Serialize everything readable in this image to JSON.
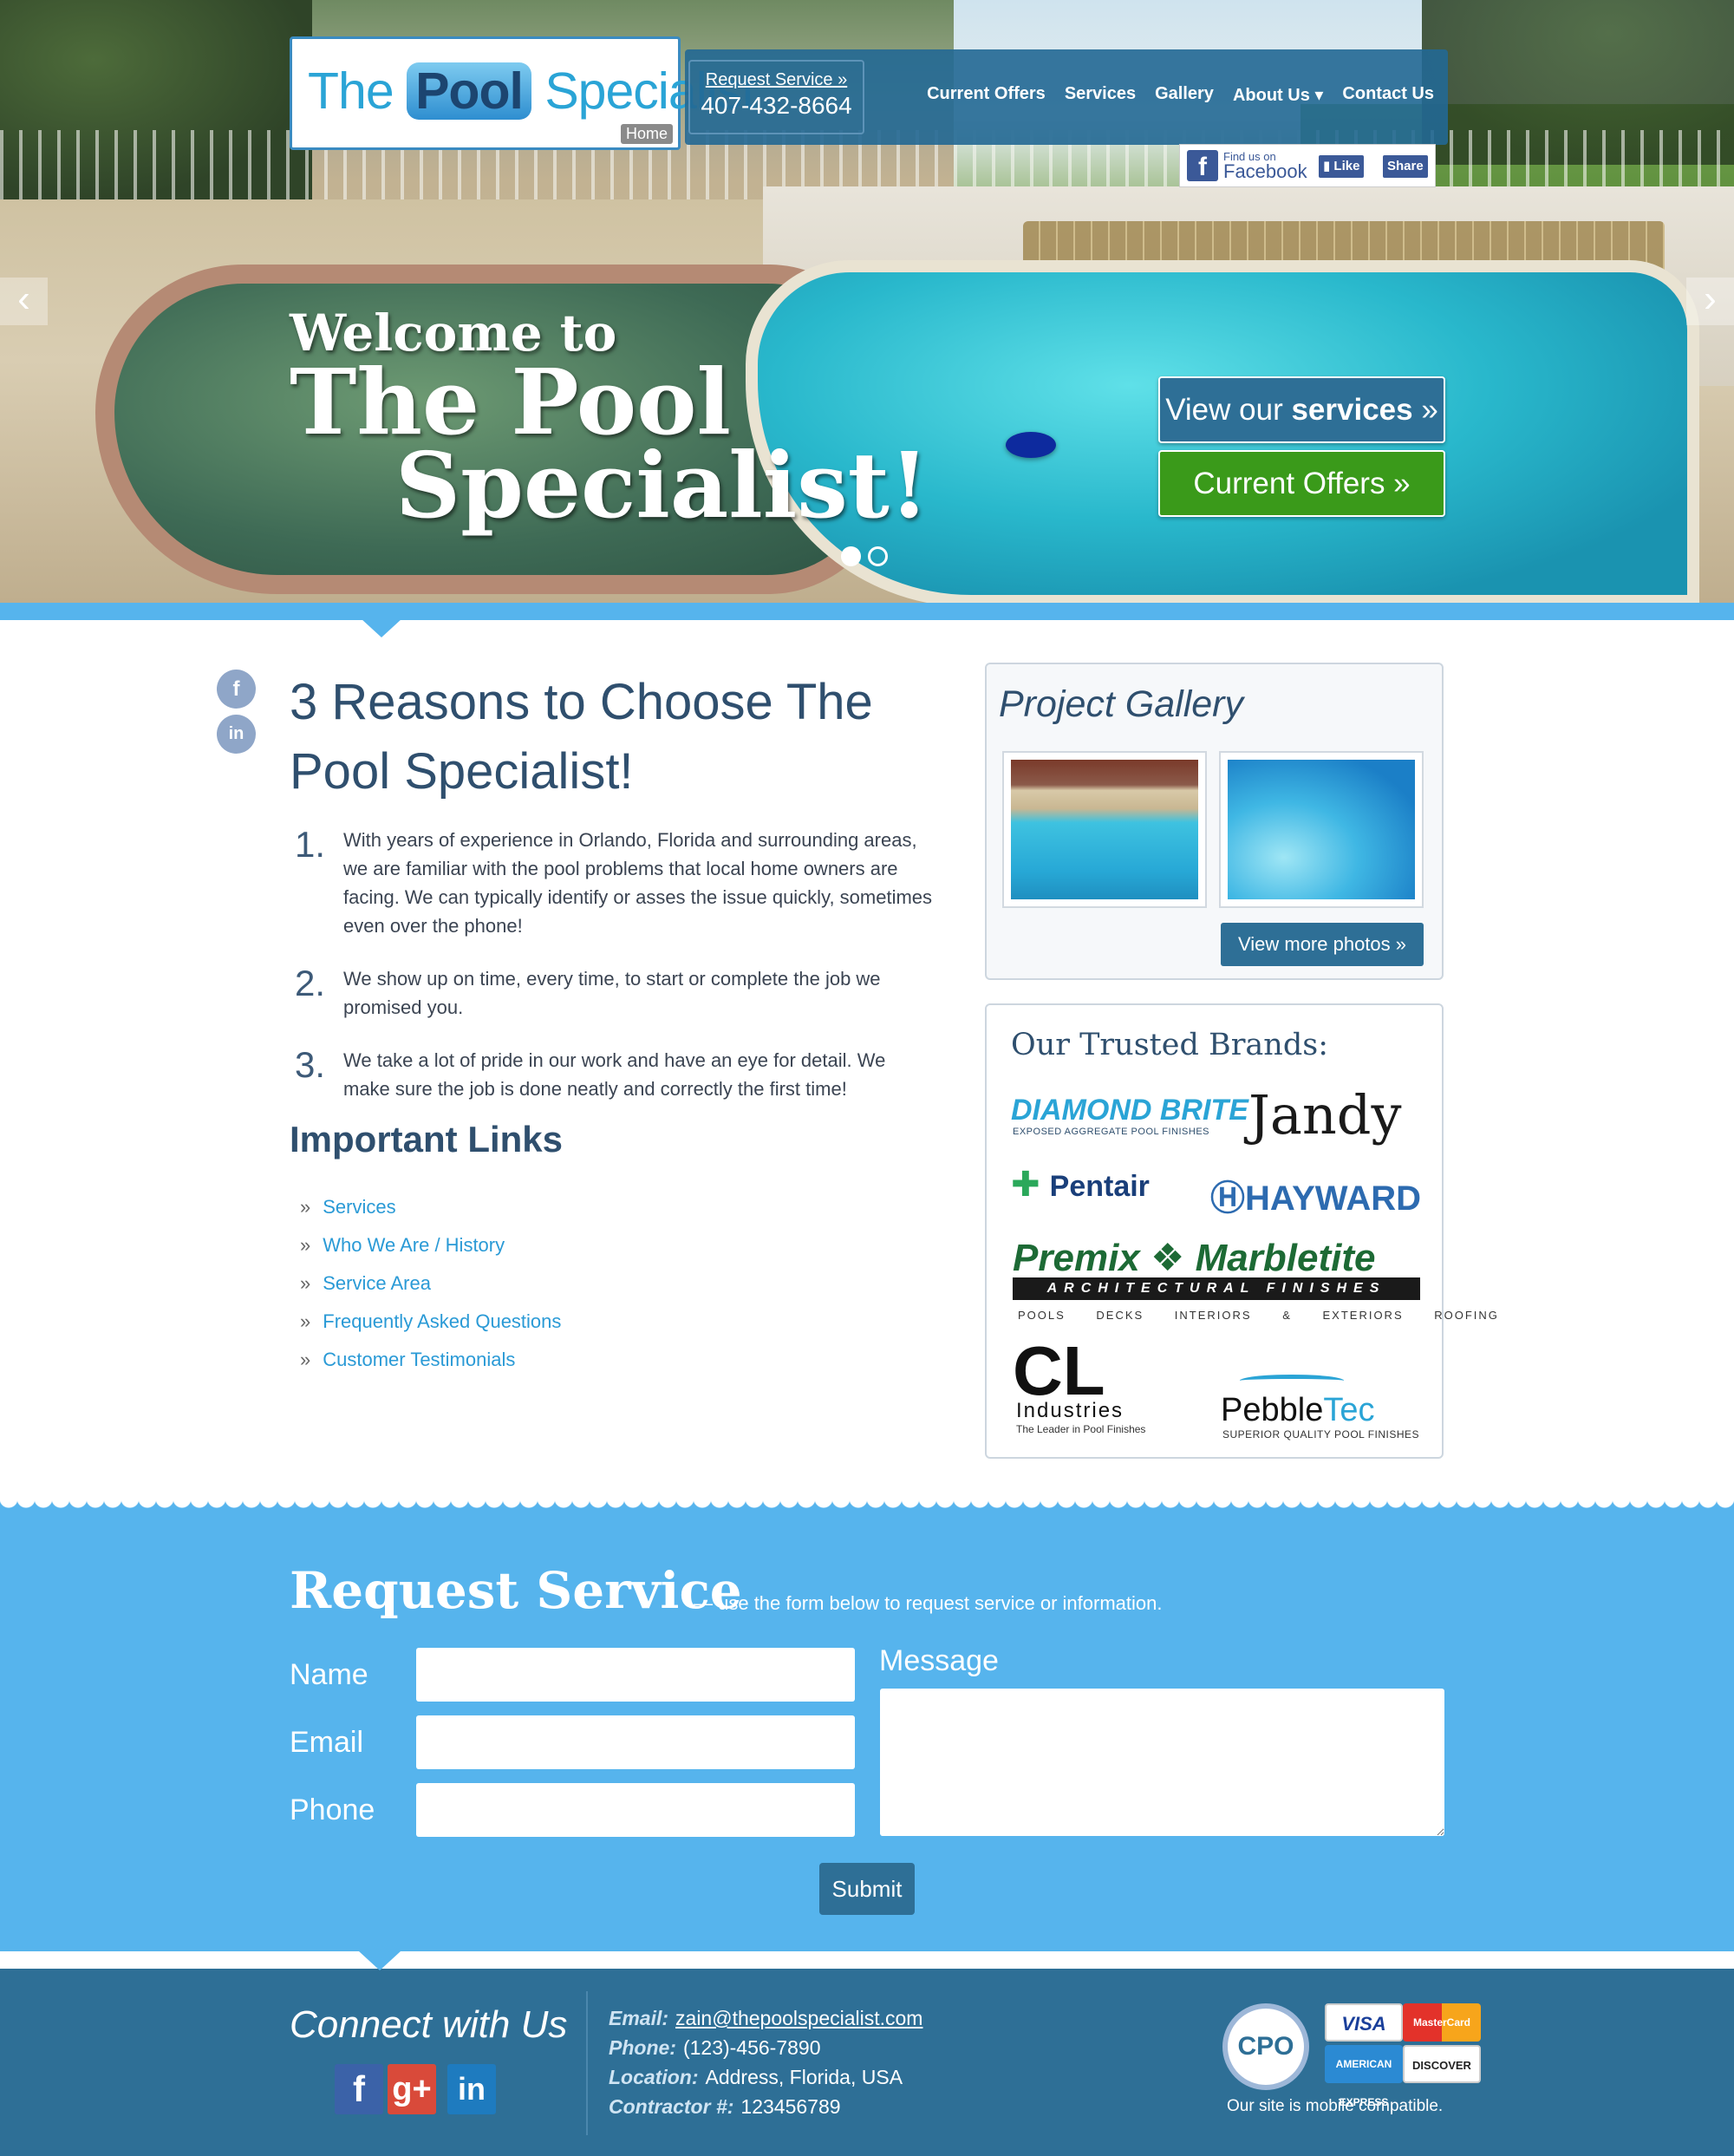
{
  "header": {
    "logo": {
      "part1": "The",
      "part2": "Pool",
      "part3": "Specialist",
      "home_tag": "Home"
    },
    "request_service": {
      "label": "Request Service »",
      "phone": "407-432-8664"
    },
    "nav": [
      "Current Offers",
      "Services",
      "Gallery",
      "About Us ▾",
      "Contact Us"
    ],
    "facebook": {
      "find_us": "Find us on",
      "brand": "Facebook",
      "like": "Like",
      "share": "Share"
    }
  },
  "hero": {
    "line1": "Welcome to",
    "line2": "The Pool",
    "line3": "Specialist!",
    "btn_services_prefix": "View our ",
    "btn_services_bold": "services",
    "btn_services_suffix": " »",
    "btn_offers": "Current Offers »",
    "arrow_left": "‹",
    "arrow_right": "›"
  },
  "main": {
    "reasons_title": "3 Reasons to Choose The Pool Specialist!",
    "reasons": [
      {
        "num": "1.",
        "text": "With years of experience in Orlando, Florida and surrounding areas, we are familiar with the pool problems that local home owners are facing. We can typically identify or asses the issue quickly, sometimes even over the phone!"
      },
      {
        "num": "2.",
        "text": "We show up on time, every time, to start or complete the job we promised you."
      },
      {
        "num": "3.",
        "text": "We take a lot of pride in our work and have an eye for detail. We make sure the job is done neatly and correctly the first time!"
      }
    ],
    "links_title": "Important Links",
    "links": [
      "Services",
      "Who We Are / History",
      "Service Area",
      "Frequently Asked Questions",
      "Customer Testimonials"
    ]
  },
  "sidebar": {
    "gallery_title": "Project Gallery",
    "view_more": "View more photos »",
    "brands_title": "Our Trusted Brands:",
    "brands": {
      "diamond": "DIAMOND BRITE",
      "diamond_sub": "EXPOSED AGGREGATE POOL FINISHES",
      "jandy": "Jandy",
      "pentair": "Pentair",
      "hayward": "HAYWARD",
      "premix": "Premix ❖ Marbletite",
      "premix_bar": "ARCHITECTURAL FINISHES",
      "premix_sub": "POOLS DECKS INTERIORS & EXTERIORS ROOFING",
      "cl": "CL",
      "cl_sub": "Industries",
      "cl_tag": "The Leader in Pool Finishes",
      "pebble": "Pebble",
      "pebble_tec": "Tec",
      "pebble_sub": "SUPERIOR QUALITY POOL FINISHES"
    }
  },
  "request_form": {
    "title": "Request Service",
    "subtitle": "— use the form below to request service or information.",
    "name_label": "Name",
    "email_label": "Email",
    "phone_label": "Phone",
    "message_label": "Message",
    "submit": "Submit"
  },
  "footer": {
    "connect": "Connect with Us",
    "email_k": "Email:",
    "email_v": "zain@thepoolspecialist.com",
    "phone_k": "Phone:",
    "phone_v": "(123)-456-7890",
    "location_k": "Location:",
    "location_v": "Address, Florida, USA",
    "contractor_k": "Contractor #:",
    "contractor_v": "123456789",
    "cpo": "CPO",
    "visa": "VISA",
    "mastercard": "MasterCard",
    "amex": "AMERICAN EXPRESS",
    "discover": "DISCOVER",
    "mobile_note": "Our site is mobile compatible."
  }
}
